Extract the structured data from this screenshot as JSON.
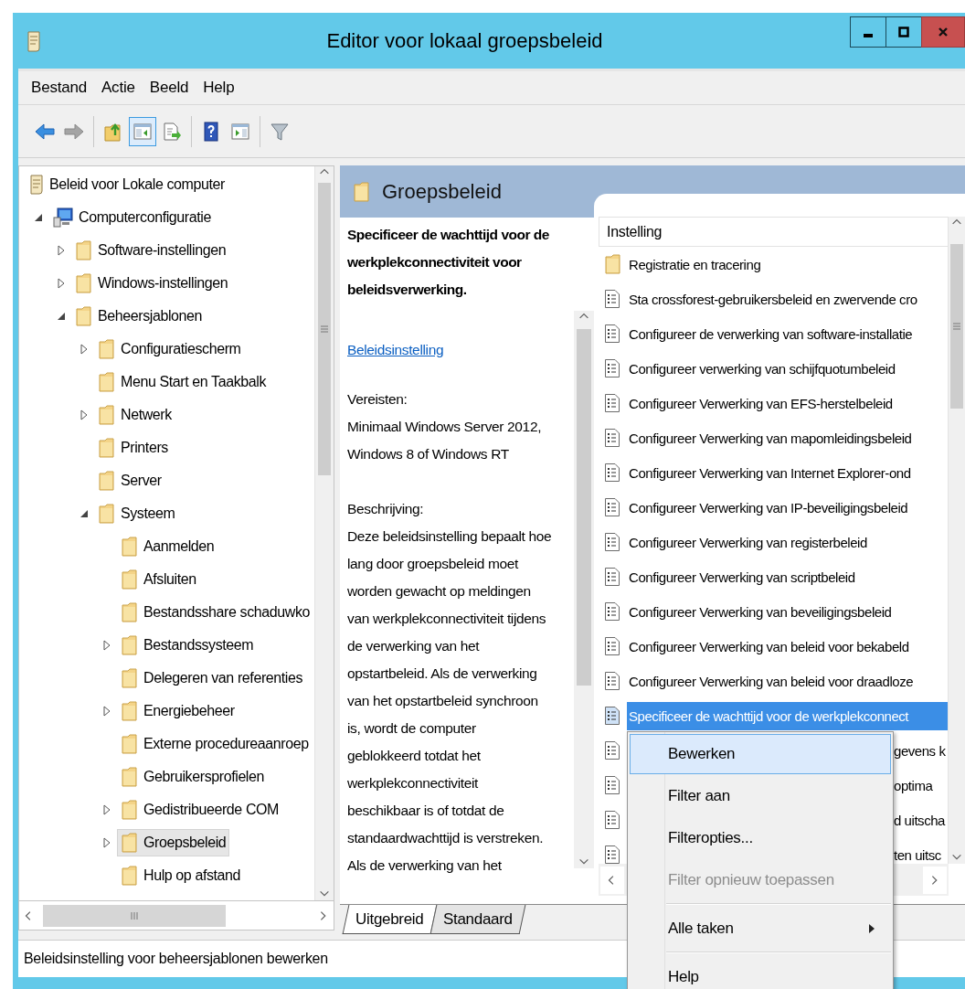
{
  "window": {
    "title": "Editor voor lokaal groepsbeleid"
  },
  "menu": [
    "Bestand",
    "Actie",
    "Beeld",
    "Help"
  ],
  "toolbar": [
    [
      {
        "kind": "back",
        "disabled": false,
        "pressed": false
      },
      {
        "kind": "forward",
        "disabled": true,
        "pressed": false
      }
    ],
    [
      {
        "kind": "up",
        "disabled": false,
        "pressed": false
      },
      {
        "kind": "show-tree",
        "disabled": false,
        "pressed": true
      },
      {
        "kind": "export",
        "disabled": false,
        "pressed": false
      }
    ],
    [
      {
        "kind": "help",
        "disabled": false,
        "pressed": false
      },
      {
        "kind": "action-pane",
        "disabled": false,
        "pressed": false
      }
    ],
    [
      {
        "kind": "filter",
        "disabled": false,
        "pressed": false
      }
    ]
  ],
  "tree": [
    {
      "kind": "policy",
      "label": "Beleid voor Lokale computer",
      "selected": false,
      "children": [
        {
          "kind": "computer",
          "label": "Computerconfiguratie",
          "expanded": true,
          "selected": false,
          "children": [
            {
              "kind": "folder",
              "label": "Software-instellingen",
              "expanded": false,
              "selected": false
            },
            {
              "kind": "folder",
              "label": "Windows-instellingen",
              "expanded": false,
              "selected": false
            },
            {
              "kind": "folder",
              "label": "Beheersjablonen",
              "expanded": true,
              "selected": false,
              "children": [
                {
                  "kind": "folder",
                  "label": "Configuratiescherm",
                  "expanded": false,
                  "selected": false
                },
                {
                  "kind": "folder",
                  "label": "Menu Start en Taakbalk",
                  "selected": false
                },
                {
                  "kind": "folder",
                  "label": "Netwerk",
                  "expanded": false,
                  "selected": false
                },
                {
                  "kind": "folder",
                  "label": "Printers",
                  "selected": false
                },
                {
                  "kind": "folder",
                  "label": "Server",
                  "selected": false
                },
                {
                  "kind": "folder",
                  "label": "Systeem",
                  "expanded": true,
                  "selected": false,
                  "children": [
                    {
                      "kind": "folder",
                      "label": "Aanmelden",
                      "selected": false
                    },
                    {
                      "kind": "folder",
                      "label": "Afsluiten",
                      "selected": false
                    },
                    {
                      "kind": "folder",
                      "label": "Bestandsshare schaduwko",
                      "selected": false
                    },
                    {
                      "kind": "folder",
                      "label": "Bestandssysteem",
                      "expanded": false,
                      "selected": false
                    },
                    {
                      "kind": "folder",
                      "label": "Delegeren van referenties",
                      "selected": false
                    },
                    {
                      "kind": "folder",
                      "label": "Energiebeheer",
                      "expanded": false,
                      "selected": false
                    },
                    {
                      "kind": "folder",
                      "label": "Externe procedureaanroep",
                      "selected": false
                    },
                    {
                      "kind": "folder",
                      "label": "Gebruikersprofielen",
                      "selected": false
                    },
                    {
                      "kind": "folder",
                      "label": "Gedistribueerde COM",
                      "expanded": false,
                      "selected": false
                    },
                    {
                      "kind": "folder",
                      "label": "Groepsbeleid",
                      "expanded": false,
                      "selected": true
                    },
                    {
                      "kind": "folder",
                      "label": "Hulp op afstand",
                      "selected": false
                    }
                  ]
                }
              ]
            }
          ]
        }
      ]
    }
  ],
  "details": {
    "header": "Groepsbeleid",
    "title": "Specificeer de wachttijd voor de werkplekconnectiviteit voor beleidsverwerking.",
    "link": "Beleidsinstelling",
    "requirements_label": "Vereisten:",
    "requirements": [
      "Minimaal Windows Server 2012,",
      "Windows 8 of Windows RT"
    ],
    "description_label": "Beschrijving:",
    "description": [
      "Deze beleidsinstelling bepaalt hoe",
      "lang door groepsbeleid moet",
      "worden gewacht op meldingen",
      "van werkplekconnectiviteit tijdens",
      "de verwerking van het",
      "opstartbeleid. Als de verwerking",
      "van het opstartbeleid synchroon",
      "is, wordt de computer",
      "geblokkeerd totdat het",
      "werkplekconnectiviteit",
      "beschikbaar is of totdat de",
      "standaardwachttijd is verstreken.",
      "Als de verwerking van het"
    ]
  },
  "settings_list": {
    "column": "Instelling",
    "rows": [
      {
        "kind": "folder",
        "label": "Registratie en tracering",
        "selected": false,
        "covered": false
      },
      {
        "kind": "setting",
        "label": "Sta crossforest-gebruikersbeleid en zwervende cro",
        "selected": false,
        "covered": false
      },
      {
        "kind": "setting",
        "label": "Configureer de verwerking van software-installatie",
        "selected": false,
        "covered": false
      },
      {
        "kind": "setting",
        "label": "Configureer verwerking van schijfquotumbeleid",
        "selected": false,
        "covered": false
      },
      {
        "kind": "setting",
        "label": "Configureer Verwerking van EFS-herstelbeleid",
        "selected": false,
        "covered": false
      },
      {
        "kind": "setting",
        "label": "Configureer Verwerking van mapomleidingsbeleid",
        "selected": false,
        "covered": false
      },
      {
        "kind": "setting",
        "label": "Configureer Verwerking van Internet Explorer-ond",
        "selected": false,
        "covered": false
      },
      {
        "kind": "setting",
        "label": "Configureer Verwerking van IP-beveiligingsbeleid",
        "selected": false,
        "covered": false
      },
      {
        "kind": "setting",
        "label": "Configureer Verwerking van registerbeleid",
        "selected": false,
        "covered": false
      },
      {
        "kind": "setting",
        "label": "Configureer Verwerking van scriptbeleid",
        "selected": false,
        "covered": false
      },
      {
        "kind": "setting",
        "label": "Configureer Verwerking van beveiligingsbeleid",
        "selected": false,
        "covered": false
      },
      {
        "kind": "setting",
        "label": "Configureer Verwerking van beleid voor bekabeld",
        "selected": false,
        "covered": false
      },
      {
        "kind": "setting",
        "label": "Configureer Verwerking van beleid voor draadloze",
        "selected": false,
        "covered": false
      },
      {
        "kind": "setting",
        "label": "Specificeer de wachttijd voor de werkplekconnect",
        "selected": true,
        "covered": false
      },
      {
        "kind": "setting",
        "label": "gevens k",
        "selected": false,
        "covered": true
      },
      {
        "kind": "setting",
        "label": "optima",
        "selected": false,
        "covered": true
      },
      {
        "kind": "setting",
        "label": "d uitscha",
        "selected": false,
        "covered": true
      },
      {
        "kind": "setting",
        "label": "ten uitsc",
        "selected": false,
        "covered": true
      }
    ]
  },
  "tabs": [
    {
      "label": "Uitgebreid",
      "selected": true
    },
    {
      "label": "Standaard",
      "selected": false
    }
  ],
  "status_bar": "Beleidsinstelling voor beheersjablonen bewerken",
  "context_menu": [
    {
      "kind": "item",
      "label": "Bewerken",
      "highlighted": true,
      "disabled": false,
      "submenu": false
    },
    {
      "kind": "item",
      "label": "Filter aan",
      "highlighted": false,
      "disabled": false,
      "submenu": false
    },
    {
      "kind": "item",
      "label": "Filteropties...",
      "highlighted": false,
      "disabled": false,
      "submenu": false
    },
    {
      "kind": "item",
      "label": "Filter opnieuw toepassen",
      "highlighted": false,
      "disabled": true,
      "submenu": false
    },
    {
      "kind": "separator"
    },
    {
      "kind": "item",
      "label": "Alle taken",
      "highlighted": false,
      "disabled": false,
      "submenu": true
    },
    {
      "kind": "separator"
    },
    {
      "kind": "item",
      "label": "Help",
      "highlighted": false,
      "disabled": false,
      "submenu": false
    }
  ]
}
